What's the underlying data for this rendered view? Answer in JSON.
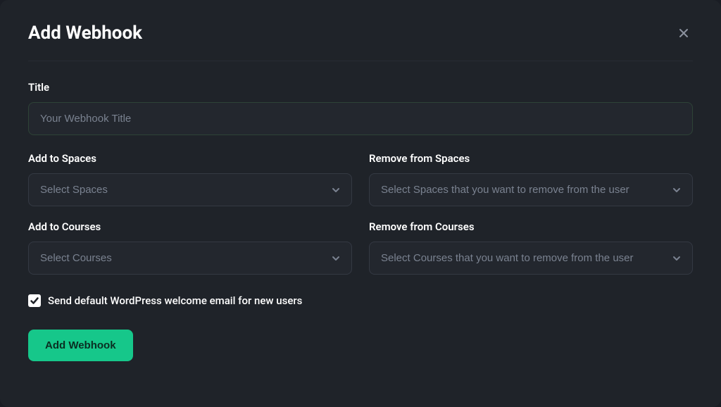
{
  "modal": {
    "title": "Add Webhook"
  },
  "form": {
    "title_label": "Title",
    "title_placeholder": "Your Webhook Title",
    "add_spaces_label": "Add to Spaces",
    "add_spaces_placeholder": "Select Spaces",
    "remove_spaces_label": "Remove from Spaces",
    "remove_spaces_placeholder": "Select Spaces that you want to remove from the user",
    "add_courses_label": "Add to Courses",
    "add_courses_placeholder": "Select Courses",
    "remove_courses_label": "Remove from Courses",
    "remove_courses_placeholder": "Select Courses that you want to remove from the user",
    "checkbox_label": "Send default WordPress welcome email for new users",
    "checkbox_checked": true,
    "submit_label": "Add Webhook"
  }
}
